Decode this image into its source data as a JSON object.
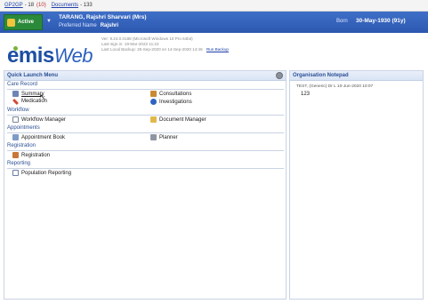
{
  "topbar": {
    "gp2gp_label": "GP2GP",
    "gp2gp_count": "- 18",
    "gp2gp_alert": "(10)",
    "documents_label": "Documents",
    "documents_count": "- 133"
  },
  "patient": {
    "status": "Active",
    "name": "TARANG, Rajshri Sharvari (Mrs)",
    "preferred_label": "Preferred Name",
    "preferred_value": "Rajshri",
    "born_label": "Born",
    "born_value": "30-May-1930 (91y)"
  },
  "logo": {
    "text_a": "emis",
    "text_b": "Web"
  },
  "sysinfo": {
    "line1": "Ver: 9.24.0.0188 (Microsoft Windows 10 Pro 64bit)",
    "line2": "Last sign in: 19-Mar-2022 11:22",
    "line3": "Last Local Backup: 25-Sep-2020 on 14-Sep-2020 14:46",
    "run_backup": "Run Backup"
  },
  "quick_launch": {
    "title": "Quick Launch Menu",
    "sections": [
      {
        "title": "Care Record"
      },
      {
        "title": "Workflow"
      },
      {
        "title": "Appointments"
      },
      {
        "title": "Registration"
      },
      {
        "title": "Reporting"
      }
    ],
    "items": {
      "summary": "Summary",
      "medication": "Medication",
      "consultations": "Consultations",
      "investigations": "Investigations",
      "workflow_manager": "Workflow Manager",
      "document_manager": "Document Manager",
      "appointment_book": "Appointment Book",
      "planner": "Planner",
      "registration": "Registration",
      "population_reporting": "Population Reporting"
    }
  },
  "notepad": {
    "title": "Organisation Notepad",
    "entry_header": "TEST, (Generic) Dr L 10-Jun-2020 10:07",
    "entry_text": "123"
  },
  "colors": {
    "banner": "#2c58b0",
    "status_green": "#2a8a3a",
    "panel_header_text": "#2a4f94",
    "link": "#1f3fa8",
    "alert_red": "#c0282b"
  },
  "icons": {
    "status": "person-status-icon",
    "gear": "gear-icon",
    "summary": "summary-icon",
    "medication": "medication-icon",
    "consultations": "consultations-icon",
    "investigations": "investigations-icon",
    "workflow_manager": "workflow-icon",
    "document_manager": "folder-icon",
    "appointment_book": "calendar-icon",
    "planner": "planner-icon",
    "registration": "registration-icon",
    "population_reporting": "report-icon",
    "cursor": "mouse-pointer-icon"
  }
}
